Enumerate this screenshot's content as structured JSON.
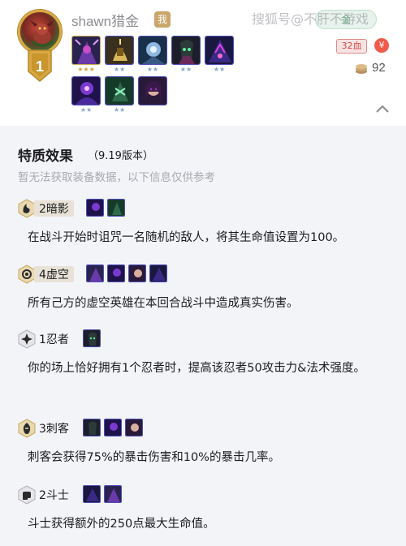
{
  "header": {
    "player_name": "shawn猎金",
    "me_badge": "我",
    "rank": "1",
    "watermark": "搜狐号@不肝不游戏",
    "gold_pill": "金",
    "hp": "32血",
    "coin_symbol": "¥",
    "gold": "92",
    "champions_row1": [
      {
        "name": "champ-1",
        "stars": "★★★",
        "tier": "gold"
      },
      {
        "name": "champ-2",
        "stars": "★★",
        "tier": "blue"
      },
      {
        "name": "champ-3",
        "stars": "★★",
        "tier": "blue"
      },
      {
        "name": "champ-4",
        "stars": "★★",
        "tier": "blue"
      },
      {
        "name": "champ-5",
        "stars": "★★",
        "tier": "blue"
      }
    ],
    "champions_row2": [
      {
        "name": "champ-6",
        "stars": "★★",
        "tier": "blue"
      },
      {
        "name": "champ-7",
        "stars": "★★",
        "tier": "blue"
      },
      {
        "name": "champ-8",
        "stars": "",
        "tier": "blue"
      }
    ]
  },
  "traits_section": {
    "title": "特质效果",
    "version": "（9.19版本）",
    "note": "暂无法获取装备数据，以下信息仅供参考",
    "traits": [
      {
        "label": "2暗影",
        "icon": "shadow-icon",
        "desc": "在战斗开始时诅咒一名随机的敌人，将其生命值设置为100。"
      },
      {
        "label": "4虚空",
        "icon": "void-icon",
        "desc": "所有己方的虚空英雄在本回合战斗中造成真实伤害。"
      },
      {
        "label": "1忍者",
        "icon": "ninja-icon",
        "desc": "你的场上恰好拥有1个忍者时，提高该忍者50攻击力&法术强度。"
      },
      {
        "label": "3刺客",
        "icon": "assassin-icon",
        "desc": "刺客会获得75%的暴击伤害和10%的暴击几率。"
      },
      {
        "label": "2斗士",
        "icon": "brawler-icon",
        "desc": "斗士获得额外的250点最大生命值。"
      }
    ]
  },
  "colors": {
    "accent_gold": "#d9a844",
    "section_bg": "#f3f4f8",
    "hp_red": "#d84848",
    "champ_border": "#4c4fb7"
  }
}
